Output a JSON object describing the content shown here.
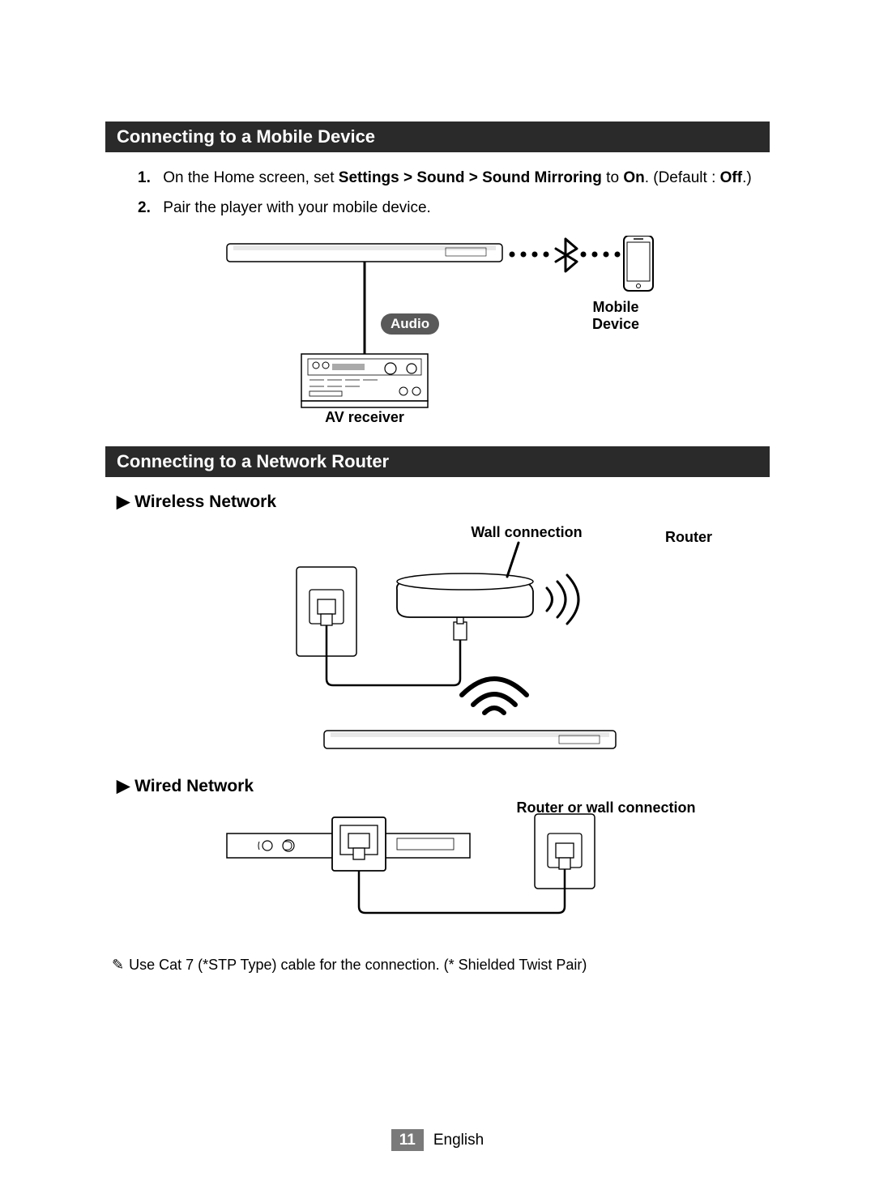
{
  "section1": {
    "title": "Connecting to a Mobile Device",
    "step1_num": "1.",
    "step1_a": "On the Home screen, set ",
    "step1_b": "Settings > Sound > Sound Mirroring",
    "step1_c": " to ",
    "step1_d": "On",
    "step1_e": ". (Default : ",
    "step1_f": "Off",
    "step1_g": ".)",
    "step2_num": "2.",
    "step2_text": "Pair the player with your mobile device.",
    "labels": {
      "audio": "Audio",
      "mobile_device": "Mobile Device",
      "av_receiver": "AV receiver"
    }
  },
  "section2": {
    "title": "Connecting to a Network Router",
    "wireless_heading": "Wireless Network",
    "wired_heading": "Wired Network",
    "labels": {
      "wall_connection": "Wall connection",
      "router": "Router",
      "router_or_wall": "Router or wall connection"
    },
    "note": "Use Cat 7 (*STP Type) cable for the connection. (* Shielded Twist Pair)"
  },
  "footer": {
    "page_number": "11",
    "language": "English"
  },
  "tri": "▶",
  "note_icon": "✎"
}
